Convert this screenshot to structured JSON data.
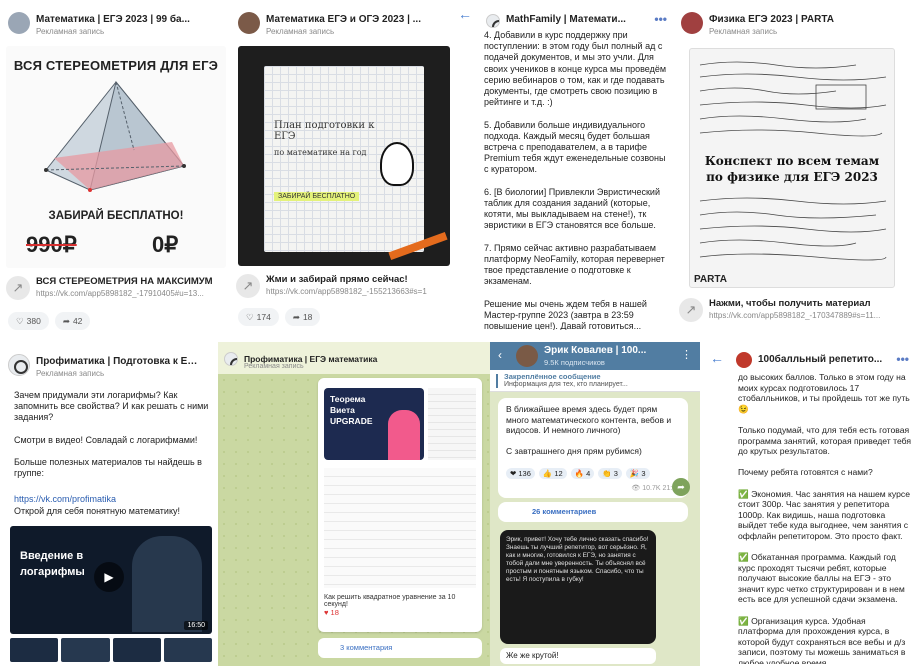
{
  "t1": {
    "name": "Математика | ЕГЭ 2023 | 99 ба...",
    "sub": "Рекламная запись",
    "title": "ВСЯ СТЕРЕОМЕТРИЯ ДЛЯ ЕГЭ",
    "free": "ЗАБИРАЙ БЕСПЛАТНО!",
    "old_price": "990₽",
    "new_price": "0₽",
    "ad_title": "ВСЯ СТЕРЕОМЕТРИЯ НА МАКСИМУМ",
    "ad_url": "https://vk.com/app5898182_-17910405#u=13...",
    "likes": "380",
    "shares": "42"
  },
  "t2": {
    "name": "Математика ЕГЭ и ОГЭ 2023 | ...",
    "sub": "Рекламная запись",
    "notebook_line1": "План подготовки к ЕГЭ",
    "notebook_line2": "по математике на год",
    "notebook_tag": "ЗАБИРАЙ БЕСПЛАТНО",
    "ad_title": "Жми и забирай прямо сейчас!",
    "ad_url": "https://vk.com/app5898182_-155213663#s=1",
    "likes": "174",
    "shares": "18"
  },
  "t3": {
    "name": "MathFamily | Математи...",
    "body": "4. Добавили в курс поддержку при поступлении: в этом году был полный ад с подачей документов, и мы это учли. Для своих учеников в конце курса мы проведём серию вебинаров о том, как и где подавать документы, где смотреть свою позицию в рейтинге и т.д. :)\n\n5. Добавили больше индивидуального подхода. Каждый месяц будет большая встреча с преподавателем, а в тарифе Premium тебя ждут еженедельные созвоны с куратором.\n\n6. [В биологии] Привлекли Эвристический таблик для создания заданий (которые, котяти, мы выкладываем на стене!), тк эвристики в ЕГЭ становятся все больше.\n\n7. Прямо сейчас активно разрабатываем платформу NeoFamily, которая перевернет твое представление о подготовке к экзаменам.\n\nРешение мы очень ждем тебя в нашей Мастер-группе 2023 (завтра в 23:59 повышение цен!). Давай готовиться..."
  },
  "t4": {
    "name": "Физика ЕГЭ 2023 | PARTA",
    "sub": "Рекламная запись",
    "caption": "Конспект по всем темам по физике для ЕГЭ 2023",
    "brand": "PARTA",
    "ad_title": "Нажми, чтобы получить материал",
    "ad_url": "https://vk.com/app5898182_-170347889#s=11..."
  },
  "t5": {
    "name": "Профиматика | Подготовка к ЕГ...",
    "sub": "Рекламная запись",
    "body": "Зачем придумали эти логарифмы? Как запомнить все свойства? И как решать с ними задания?\n\nСмотри в видео! Совладай с логарифмами!\n\nБольше полезных материалов ты найдешь в группе:",
    "link": "https://vk.com/profimatika",
    "body2": "Открой для себя понятную математику!",
    "video_title": "Введение в логарифмы",
    "duration": "16:50"
  },
  "t6": {
    "name": "Профиматика | ЕГЭ математика",
    "sub": "Рекламная запись",
    "post_title": "Теорема Виета UPGRADE",
    "post_caption": "Как решить квадратное уравнение за 10 секунд!",
    "likes": "18",
    "comments": "3 комментария"
  },
  "t7": {
    "channel": "Эрик Ковалев | 100...",
    "subs": "9.5К подписчиков",
    "pinned": "Закреплённое сообщение",
    "pinned_text": "Информация для тех, кто планирует...",
    "msg": "В ближайшее время здесь будет прям много математического контента, вебов и видосов. И немного личного)\n\nС завтрашнего дня прям рубимся)",
    "r1": "136",
    "r2": "12",
    "r3": "4",
    "r4": "3",
    "r5": "3",
    "views": "10.7K",
    "time": "21:01",
    "comments": "26 комментариев",
    "review": "Эрик, привет! Хочу тебе лично сказать спасибо! Знаешь ты лучший репетитор, вот серьёзно. Я, как и многие, готовился к ЕГЭ, но занятия с тобой дали мне уверенность. Ты объяснял всё простым и понятным языком. Спасибо, что ты есть! Я поступила в губку!",
    "final": "Же же крутой!"
  },
  "t8": {
    "name": "100балльный репетито...",
    "body": "до высоких баллов. Только в этом году на моих курсах подготовилось 17 стобалльников, и ты пройдешь тот же путь 😉\n\nТолько подумай, что для тебя есть готовая программа занятий, которая приведет тебя до крутых результатов.\n\nПочему ребята готовятся с нами?\n\n✅ Экономия. Час занятия на нашем курсе стоит 300р. Час занятия у репетитора 1000р. Как видишь, наша подготовка выйдет тебе куда выгоднее, чем занятия с оффлайн репетитором. Это просто факт.\n\n✅ Обкатанная программа. Каждый год курс проходят тысячи ребят, которые получают высокие баллы на ЕГЭ - это значит курс четко структурирован и в нем есть все для успешной сдачи экзамена.\n\n✅ Организация курса. Удобная платформа для прохождения курса, в которой будут сохраняться все вебы и д/з записи, поэтому ты можешь заниматься в любое удобное время."
  }
}
